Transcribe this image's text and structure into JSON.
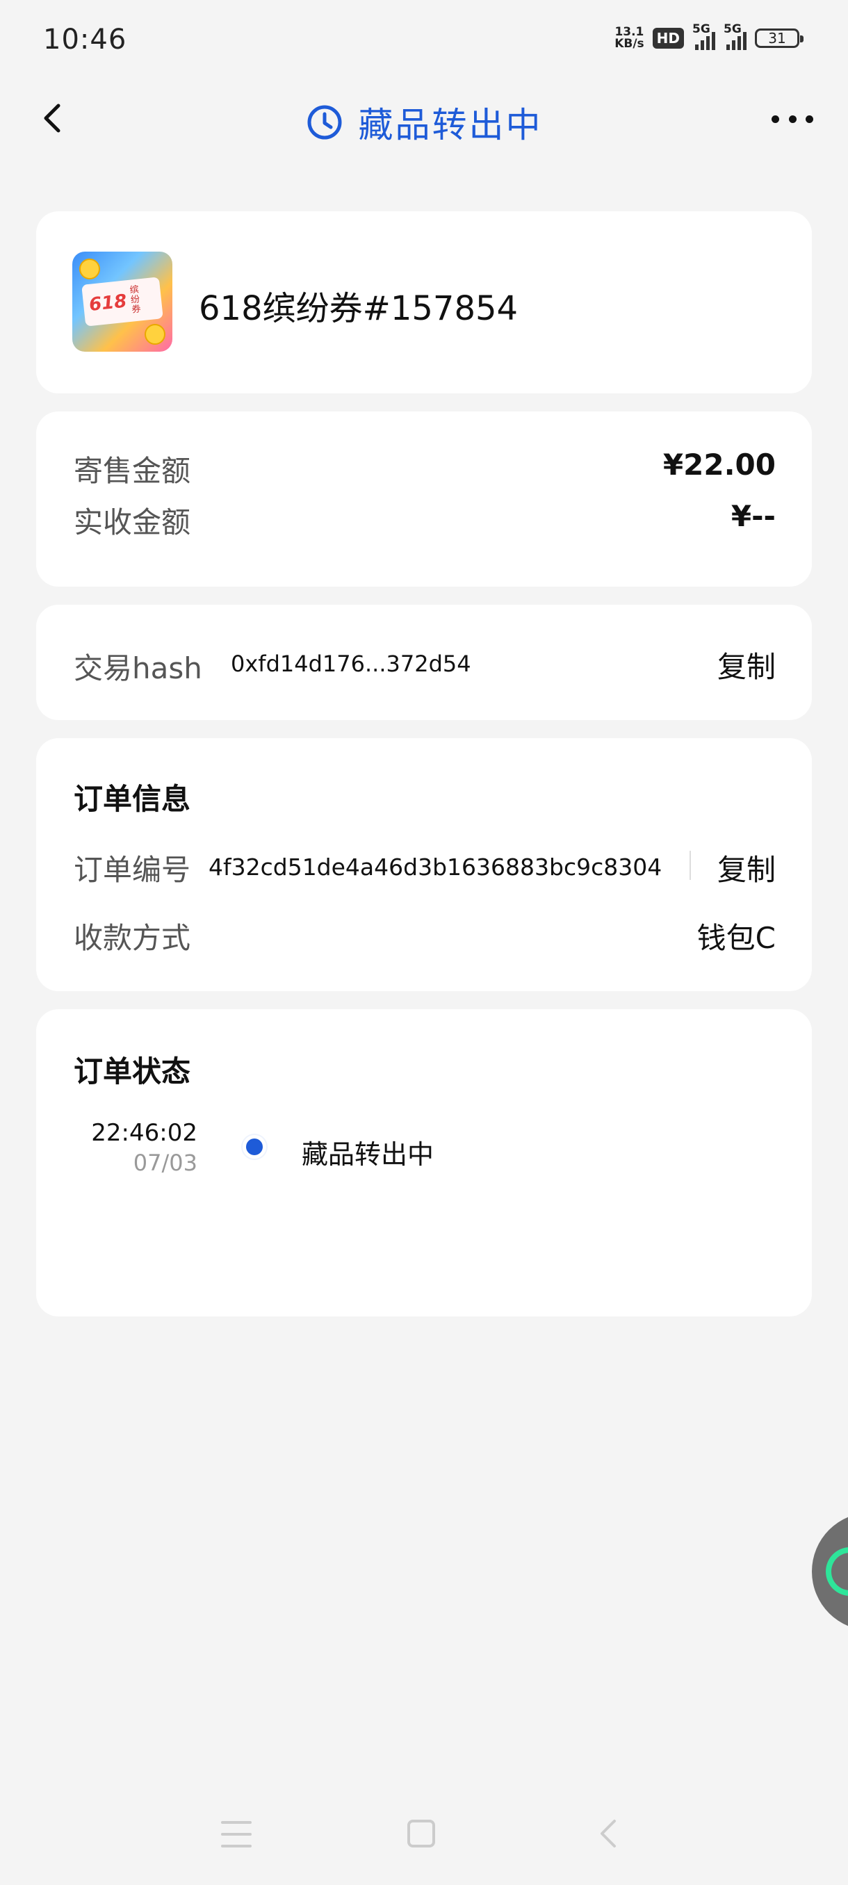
{
  "status_bar": {
    "time": "10:46",
    "net_speed_top": "13.1",
    "net_speed_bottom": "KB/s",
    "hd_label": "HD",
    "signal1_tag": "5G",
    "signal2_tag": "5G",
    "battery": "31"
  },
  "header": {
    "title": "藏品转出中",
    "accent_color": "#1e5bd8",
    "back_icon": "chevron-left-icon",
    "status_icon": "clock-icon",
    "more_icon": "more-dots-icon"
  },
  "product": {
    "name": "618缤纷券#157854",
    "thumb_text": "618",
    "thumb_side_text": "缤纷券"
  },
  "amounts": {
    "sale_label": "寄售金额",
    "sale_value": "¥22.00",
    "received_label": "实收金额",
    "received_value": "¥--"
  },
  "hash": {
    "label": "交易hash",
    "value": "0xfd14d176...372d54",
    "copy_label": "复制"
  },
  "order_info": {
    "title": "订单信息",
    "number_label": "订单编号",
    "number_value": "4f32cd51de4a46d3b1636883bc9c8304",
    "copy_label": "复制",
    "payment_label": "收款方式",
    "payment_value": "钱包C"
  },
  "order_status": {
    "title": "订单状态",
    "entries": [
      {
        "time": "22:46:02",
        "date": "07/03",
        "text": "藏品转出中"
      }
    ]
  }
}
